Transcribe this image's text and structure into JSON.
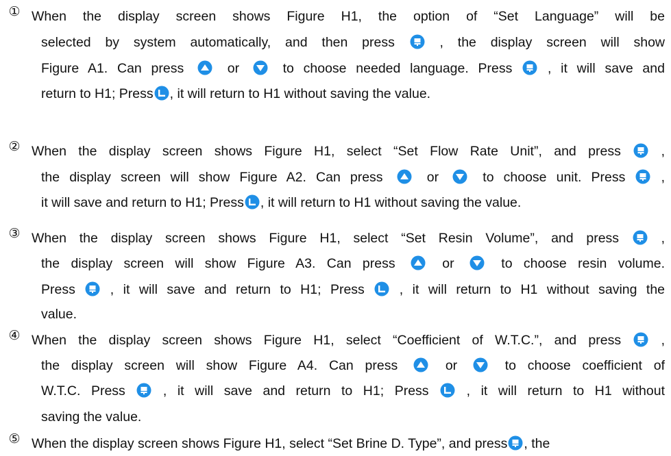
{
  "colors": {
    "icon_blue": "#1f8fe6",
    "icon_white": "#ffffff",
    "text": "#111111"
  },
  "icons": {
    "enter": "menu-enter-icon",
    "up": "up-arrow-icon",
    "down": "down-arrow-icon",
    "back": "return-icon"
  },
  "items": [
    {
      "number": "①",
      "lines": [
        [
          "When the display screen shows Figure H1, the option of “Set Language” will be"
        ],
        [
          "selected by system automatically, and then press",
          "[enter]",
          ", the display screen will show"
        ],
        [
          "Figure A1. Can press",
          "[up]",
          "or",
          "[down]",
          "to choose needed language. Press",
          "[enter]",
          ", it will save and"
        ],
        [
          "return to H1; Press",
          "[back]",
          ", it will return to H1 without saving the value."
        ]
      ]
    },
    {
      "number": "②",
      "lines": [
        [
          "When the display screen shows Figure H1, select “Set Flow Rate Unit”, and press",
          "[enter]",
          ","
        ],
        [
          "the display screen will show Figure A2. Can press",
          "[up]",
          "or",
          "[down]",
          "to choose unit. Press",
          "[enter]",
          ","
        ],
        [
          "it will save and return to H1; Press",
          "[back]",
          ", it will return to H1 without saving the value."
        ]
      ]
    },
    {
      "number": "③",
      "lines": [
        [
          "When the display screen shows Figure H1, select “Set Resin Volume”, and press",
          "[enter]",
          ","
        ],
        [
          "the display screen will show Figure A3. Can press",
          "[up]",
          "or",
          "[down]",
          "to choose resin volume."
        ],
        [
          "Press",
          "[enter]",
          ", it will save and return to H1; Press",
          "[back]",
          ", it will return to H1 without saving the"
        ],
        [
          "value."
        ]
      ]
    },
    {
      "number": "④",
      "lines": [
        [
          "When the display screen shows Figure H1, select “Coefficient of W.T.C.”, and press",
          "[enter]",
          ","
        ],
        [
          "the display screen will show Figure A4. Can press",
          "[up]",
          "or",
          "[down]",
          "to choose coefficient of"
        ],
        [
          "W.T.C. Press",
          "[enter]",
          ", it will save and return to H1; Press",
          "[back]",
          ", it will return to H1 without"
        ],
        [
          "saving the value."
        ]
      ]
    },
    {
      "number": "⑤",
      "lines": [
        [
          "When the display screen shows Figure H1, select “Set Brine D. Type”, and press",
          "[enter]",
          ", the"
        ]
      ]
    }
  ]
}
